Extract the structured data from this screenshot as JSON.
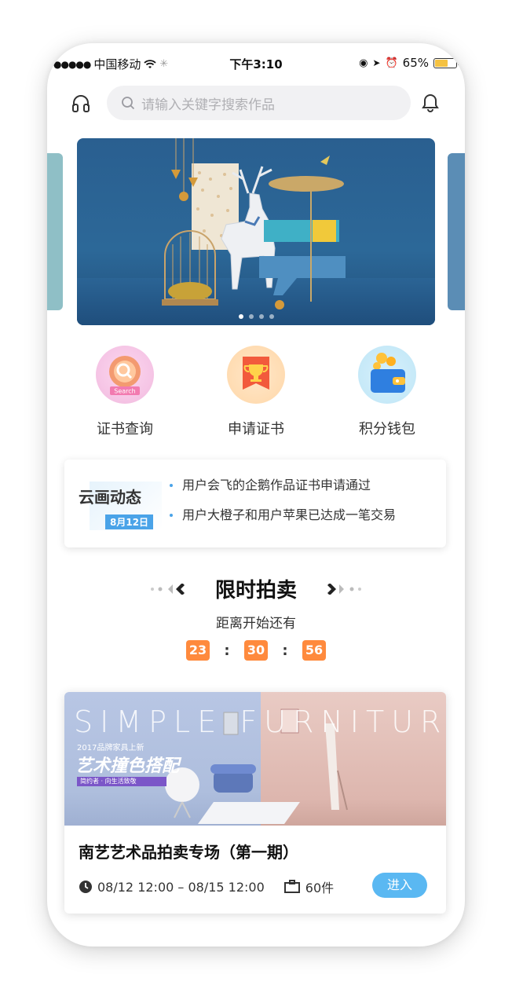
{
  "status_bar": {
    "carrier": "中国移动",
    "time": "下午3:10",
    "battery": "65%",
    "battery_level": 0.65
  },
  "header": {
    "search_placeholder": "请输入关键字搜索作品",
    "left_icon": "headset-icon",
    "right_icon": "bell-icon"
  },
  "banner": {
    "pages": 4,
    "active_page": 1
  },
  "quick_entries": [
    {
      "label": "证书查询",
      "icon": "certificate-search-icon",
      "badge_text": "Search"
    },
    {
      "label": "申请证书",
      "icon": "trophy-banner-icon"
    },
    {
      "label": "积分钱包",
      "icon": "wallet-coins-icon"
    }
  ],
  "news": {
    "title": "云画动态",
    "date": "8月12日",
    "items": [
      "用户会飞的企鹅作品证书申请通过",
      "用户大橙子和用户苹果已达成一笔交易"
    ]
  },
  "auction": {
    "title": "限时拍卖",
    "subtitle": "距离开始还有",
    "countdown": {
      "hours": "23",
      "minutes": "30",
      "seconds": "56"
    },
    "card": {
      "image_word": "SIMPLE FURNITURE",
      "image_line1": "2017品牌家具上新",
      "image_line2": "艺术撞色搭配",
      "image_line3": "简约者 · 向生活致敬",
      "name": "南艺艺术品拍卖专场（第一期）",
      "time_range": "08/12 12:00 – 08/15 12:00",
      "count": "60件",
      "enter_label": "进入"
    }
  },
  "colors": {
    "accent_blue": "#5ab8f2",
    "countdown_orange": "#ff8a3d",
    "news_blue": "#4aa3e8"
  }
}
